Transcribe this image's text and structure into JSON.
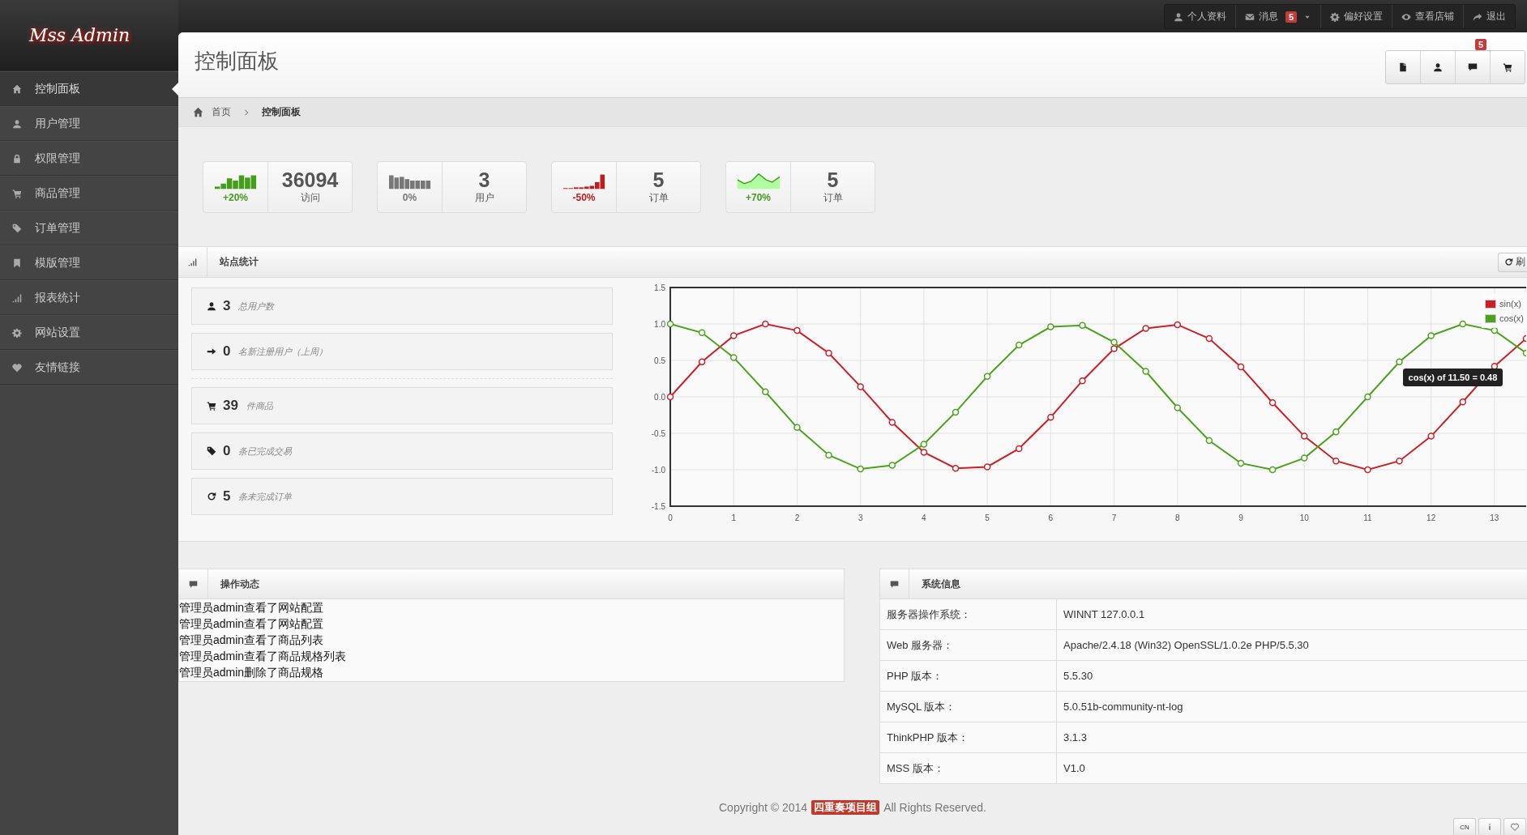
{
  "logo": "Mss Admin",
  "top_nav": [
    {
      "label": "个人资料",
      "dropdown": false
    },
    {
      "label": "消息",
      "badge": "5",
      "dropdown": true
    },
    {
      "label": "偏好设置",
      "dropdown": false
    },
    {
      "label": "查看店铺",
      "dropdown": false
    },
    {
      "label": "退出",
      "dropdown": false
    }
  ],
  "sidebar": {
    "items": [
      {
        "label": "控制面板",
        "selected": true
      },
      {
        "label": "用户管理",
        "selected": false
      },
      {
        "label": "权限管理",
        "selected": false
      },
      {
        "label": "商品管理",
        "selected": false
      },
      {
        "label": "订单管理",
        "selected": false
      },
      {
        "label": "模版管理",
        "selected": false
      },
      {
        "label": "报表统计",
        "selected": false
      },
      {
        "label": "网站设置",
        "selected": false
      },
      {
        "label": "友情链接",
        "selected": false
      }
    ]
  },
  "page_title": "控制面板",
  "header_toolbar": {
    "badge": "5"
  },
  "breadcrumb": [
    "首页",
    "控制面板"
  ],
  "stats": [
    {
      "kind": "bars",
      "color": "#459d1c",
      "change": "+20%",
      "value": "36094",
      "label": "访问"
    },
    {
      "kind": "bars",
      "color": "#777777",
      "change": "0%",
      "value": "3",
      "label": "用户"
    },
    {
      "kind": "bars",
      "color": "#ba1e20",
      "change": "-50%",
      "value": "5",
      "label": "订单"
    },
    {
      "kind": "area",
      "color": "#459d1c",
      "change": "+70%",
      "value": "5",
      "label": "订单"
    }
  ],
  "site_stats": {
    "title": "站点统计",
    "refresh": "刷",
    "items": [
      {
        "value": "3",
        "label": "总用户数"
      },
      {
        "value": "0",
        "label": "名新注册用户（上周）"
      },
      {
        "value": "39",
        "label": "件商品"
      },
      {
        "value": "0",
        "label": "条已完成交易"
      },
      {
        "value": "5",
        "label": "条未完成订单"
      }
    ],
    "chart_data": {
      "type": "line",
      "x": [
        0,
        0.5,
        1,
        1.5,
        2,
        2.5,
        3,
        3.5,
        4,
        4.5,
        5,
        5.5,
        6,
        6.5,
        7,
        7.5,
        8,
        8.5,
        9,
        9.5,
        10,
        10.5,
        11,
        11.5,
        12,
        12.5,
        13,
        13.5
      ],
      "series": [
        {
          "name": "sin(x)",
          "color": "#cb2027",
          "marker": "circle",
          "values": [
            0,
            0.48,
            0.84,
            1.0,
            0.91,
            0.6,
            0.14,
            -0.35,
            -0.76,
            -0.98,
            -0.96,
            -0.71,
            -0.28,
            0.22,
            0.66,
            0.94,
            0.99,
            0.8,
            0.41,
            -0.08,
            -0.54,
            -0.88,
            -1.0,
            -0.88,
            -0.54,
            -0.07,
            0.42,
            0.8
          ]
        },
        {
          "name": "cos(x)",
          "color": "#4da21c",
          "marker": "circle",
          "values": [
            1,
            0.88,
            0.54,
            0.07,
            -0.42,
            -0.8,
            -0.99,
            -0.94,
            -0.65,
            -0.21,
            0.28,
            0.71,
            0.96,
            0.98,
            0.75,
            0.35,
            -0.15,
            -0.6,
            -0.91,
            -1.0,
            -0.84,
            -0.48,
            0.0,
            0.48,
            0.84,
            1.0,
            0.91,
            0.6
          ]
        }
      ],
      "grid": true,
      "legend": true,
      "xlim": [
        0,
        13.5
      ],
      "ylim": [
        -1.5,
        1.5
      ],
      "xticks": [
        0,
        1,
        2,
        3,
        4,
        5,
        6,
        7,
        8,
        9,
        10,
        11,
        12,
        13
      ],
      "yticks": [
        {
          "value": 1.5,
          "label": "1.5"
        },
        {
          "value": 1,
          "label": "1.0"
        },
        {
          "value": 0.5,
          "label": "0.5"
        },
        {
          "value": 0,
          "label": "0.0"
        },
        {
          "value": -0.5,
          "label": "-0.5"
        },
        {
          "value": -1,
          "label": "-1.0"
        },
        {
          "value": -1.5,
          "label": "-1.5"
        }
      ],
      "annotations": [
        {
          "x": 11.5,
          "y": 0.48,
          "text": "cos(x) of 11.50 = 0.48"
        }
      ]
    }
  },
  "activity": {
    "title": "操作动态",
    "entries": [
      "管理员admin查看了网站配置",
      "管理员admin查看了网站配置",
      "管理员admin查看了商品列表",
      "管理员admin查看了商品规格列表",
      "管理员admin删除了商品规格"
    ]
  },
  "system_info": {
    "title": "系统信息",
    "rows": [
      {
        "label": "服务器操作系统：",
        "value": "WINNT 127.0.0.1"
      },
      {
        "label": "Web 服务器：",
        "value": "Apache/2.4.18 (Win32) OpenSSL/1.0.2e PHP/5.5.30"
      },
      {
        "label": "PHP 版本：",
        "value": "5.5.30"
      },
      {
        "label": "MySQL 版本：",
        "value": "5.0.51b-community-nt-log"
      },
      {
        "label": "ThinkPHP 版本：",
        "value": "3.1.3"
      },
      {
        "label": "MSS 版本：",
        "value": "V1.0"
      }
    ]
  },
  "footer": {
    "prefix": "Copyright © 2014",
    "brand": "四重奏项目组",
    "suffix": "All Rights Reserved."
  },
  "corner_buttons": [
    "CN"
  ]
}
